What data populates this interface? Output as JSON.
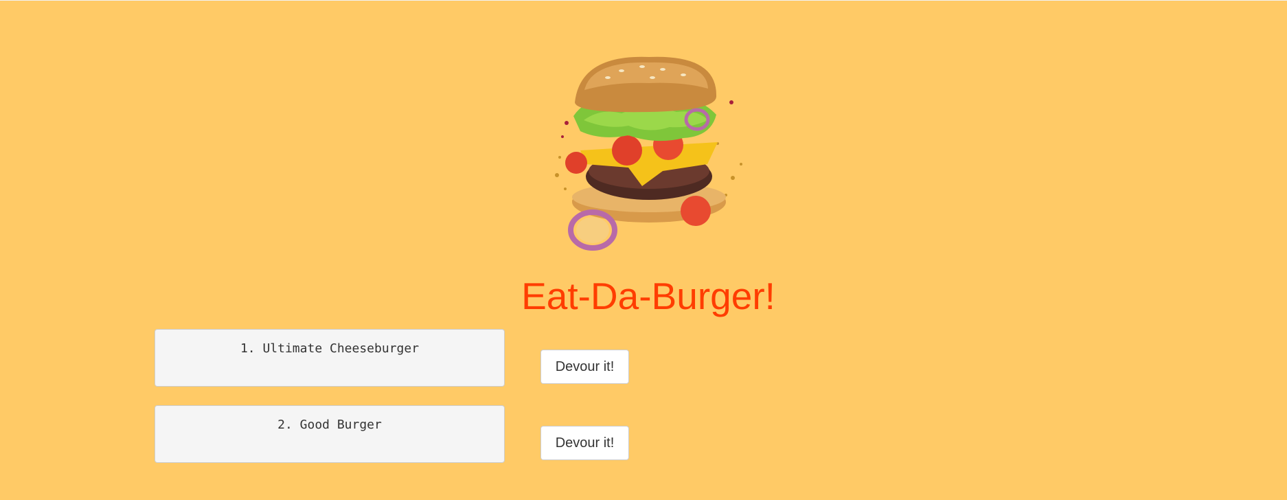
{
  "colors": {
    "background": "#ffca66",
    "title": "#ff3d00",
    "box_bg": "#f5f5f5",
    "button_bg": "#ffffff"
  },
  "header": {
    "image_icon": "flying-burger-image",
    "title": "Eat-Da-Burger!"
  },
  "burgers": [
    {
      "label": "1. Ultimate Cheeseburger",
      "button_label": "Devour it!"
    },
    {
      "label": "2. Good Burger",
      "button_label": "Devour it!"
    }
  ]
}
